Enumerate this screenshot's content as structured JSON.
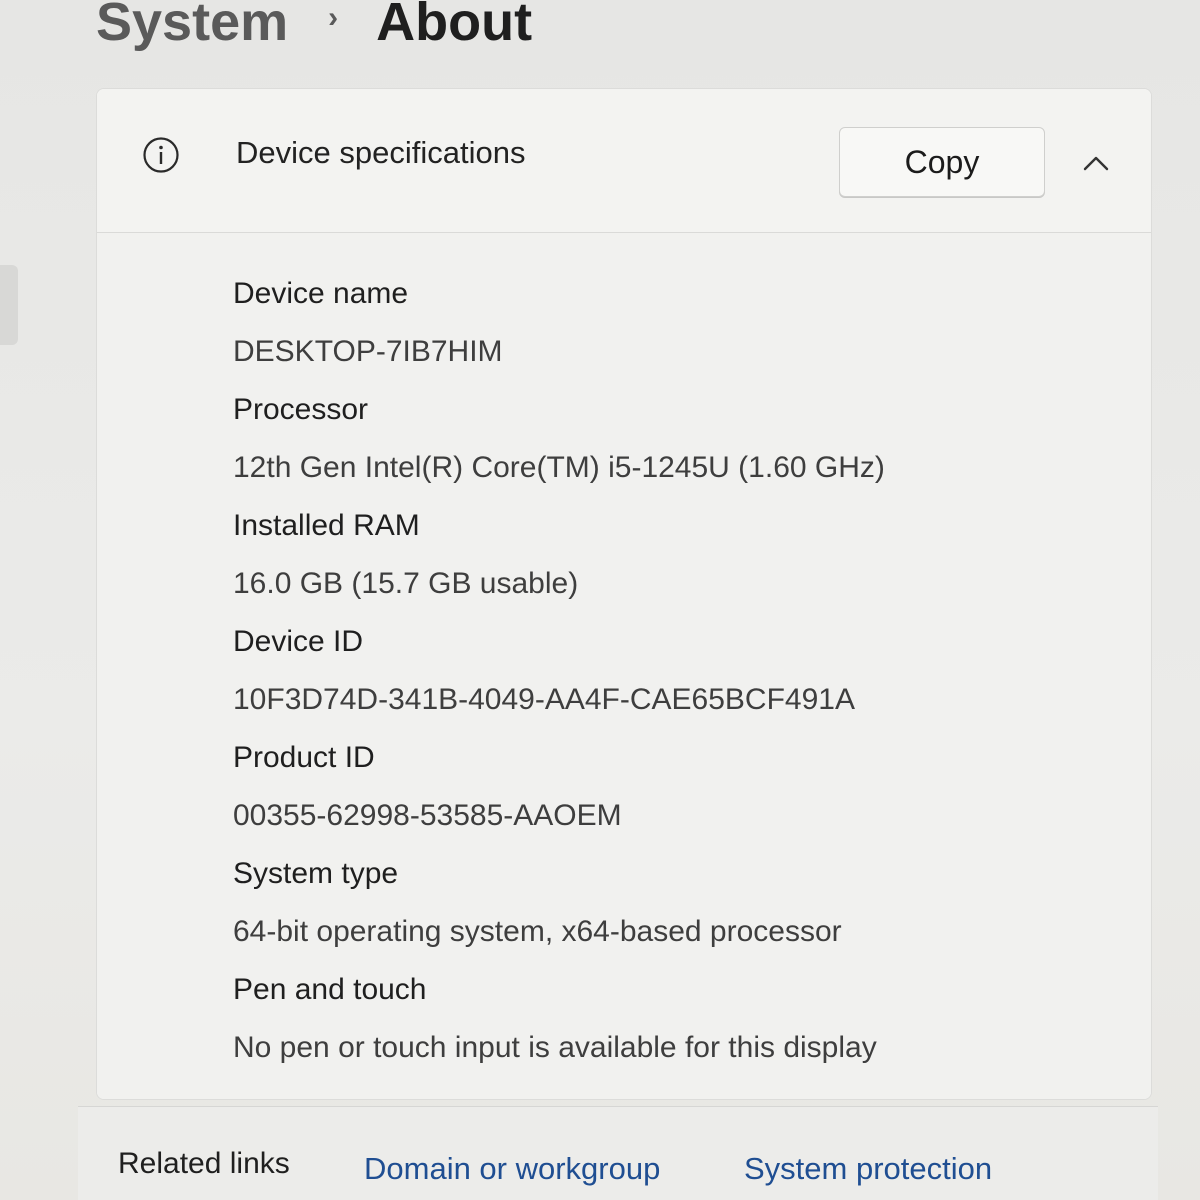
{
  "breadcrumb": {
    "parent": "System",
    "separator": "›",
    "current": "About"
  },
  "device_specs": {
    "icon": "info-icon",
    "title": "Device specifications",
    "copy_label": "Copy",
    "collapse_icon": "chevron-up-icon",
    "rows": [
      {
        "label": "Device name",
        "value": "DESKTOP-7IB7HIM"
      },
      {
        "label": "Processor",
        "value": "12th Gen Intel(R) Core(TM) i5-1245U (1.60 GHz)"
      },
      {
        "label": "Installed RAM",
        "value": "16.0 GB (15.7 GB usable)"
      },
      {
        "label": "Device ID",
        "value": "10F3D74D-341B-4049-AA4F-CAE65BCF491A"
      },
      {
        "label": "Product ID",
        "value": "00355-62998-53585-AAOEM"
      },
      {
        "label": "System type",
        "value": "64-bit operating system, x64-based processor"
      },
      {
        "label": "Pen and touch",
        "value": "No pen or touch input is available for this display"
      }
    ]
  },
  "related_links": {
    "title": "Related links",
    "domain_link": "Domain or workgroup",
    "protection_link": "System protection"
  },
  "colors": {
    "link": "#1f4e92",
    "card_background": "#f2f2f0"
  }
}
